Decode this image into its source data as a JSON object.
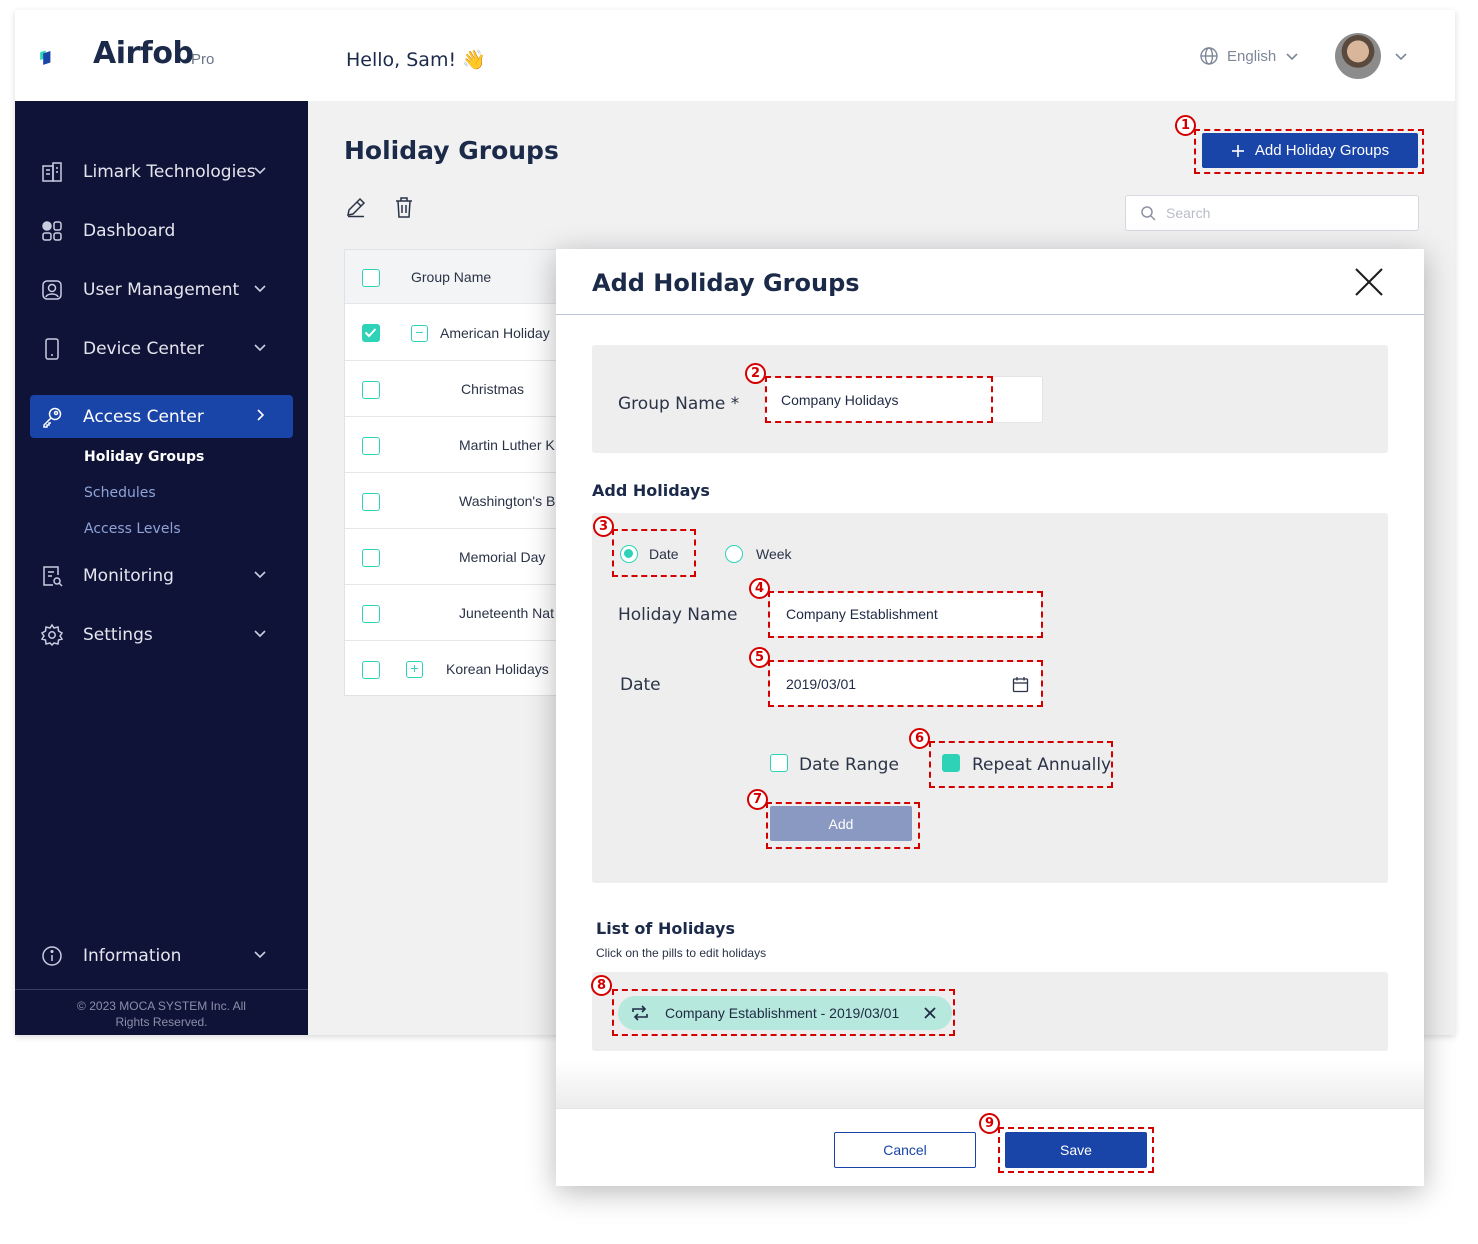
{
  "brand": {
    "name": "Airfob",
    "edition": "Pro"
  },
  "header": {
    "greeting": "Hello, Sam! 👋",
    "language": "English"
  },
  "sidebar": {
    "items": [
      {
        "label": "Limark Technologies"
      },
      {
        "label": "Dashboard"
      },
      {
        "label": "User Management"
      },
      {
        "label": "Device Center"
      },
      {
        "label": "Access Center"
      },
      {
        "label": "Monitoring"
      },
      {
        "label": "Settings"
      },
      {
        "label": "Information"
      }
    ],
    "subitems": [
      {
        "label": "Holiday Groups"
      },
      {
        "label": "Schedules"
      },
      {
        "label": "Access Levels"
      }
    ],
    "copyright_line1": "© 2023 MOCA SYSTEM Inc. All",
    "copyright_line2": "Rights Reserved."
  },
  "page": {
    "title": "Holiday Groups",
    "add_button": "Add Holiday Groups",
    "search_placeholder": "Search"
  },
  "table": {
    "header": "Group Name",
    "rows": [
      {
        "name": "American Holiday",
        "checked": true,
        "expander": "−"
      },
      {
        "name": "Christmas",
        "checked": false
      },
      {
        "name": "Martin Luther K",
        "checked": false
      },
      {
        "name": "Washington's B",
        "checked": false
      },
      {
        "name": "Memorial Day",
        "checked": false
      },
      {
        "name": "Juneteenth Nat",
        "checked": false
      },
      {
        "name": "Korean Holidays",
        "checked": false,
        "expander": "+"
      }
    ]
  },
  "modal": {
    "title": "Add Holiday Groups",
    "group_name_label": "Group Name *",
    "group_name_value": "Company Holidays",
    "add_holidays_title": "Add Holidays",
    "radio_date": "Date",
    "radio_week": "Week",
    "holiday_name_label": "Holiday Name",
    "holiday_name_value": "Company Establishment",
    "date_label": "Date",
    "date_value": "2019/03/01",
    "date_range_label": "Date Range",
    "repeat_annually_label": "Repeat Annually",
    "add_button": "Add",
    "list_title": "List of Holidays",
    "list_hint": "Click on the pills to edit holidays",
    "pill_text": "Company Establishment - 2019/03/01",
    "cancel_button": "Cancel",
    "save_button": "Save"
  },
  "annotations": [
    "1",
    "2",
    "3",
    "4",
    "5",
    "6",
    "7",
    "8",
    "9"
  ],
  "colors": {
    "navy": "#101338",
    "primary": "#1944a8",
    "teal": "#2ed3b7",
    "annotation": "#d40000"
  }
}
